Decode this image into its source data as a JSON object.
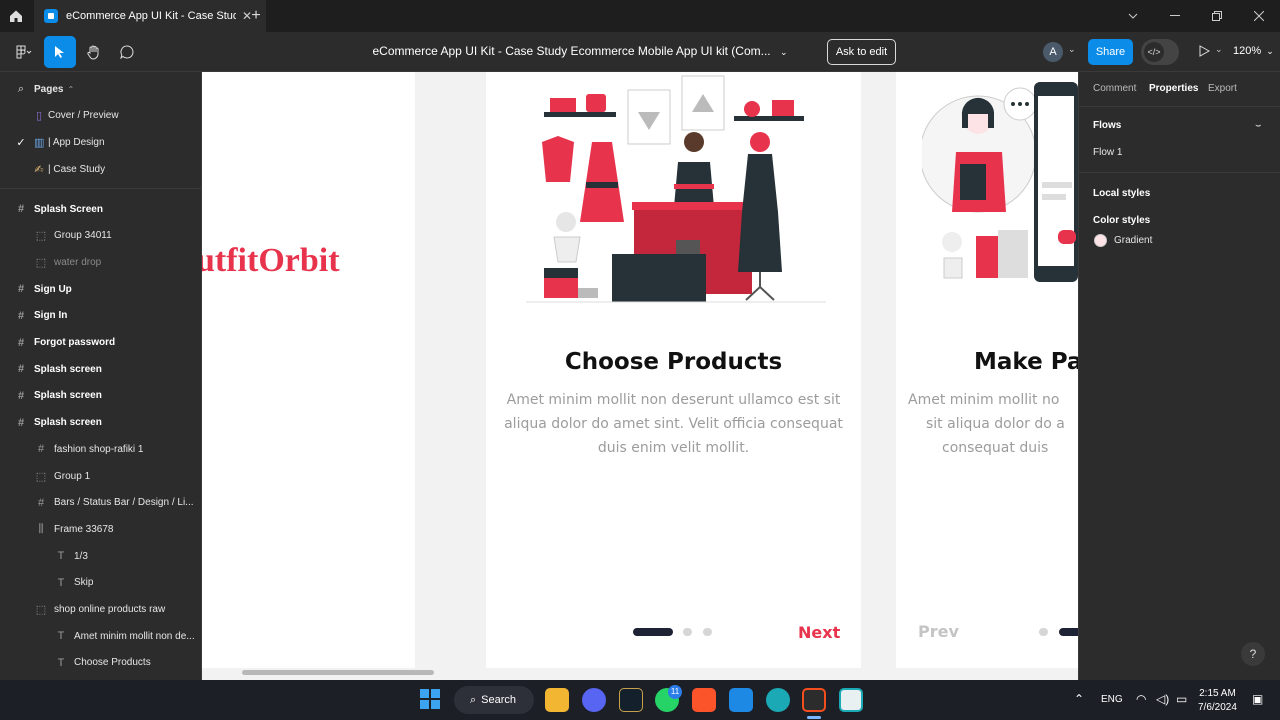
{
  "browser": {
    "tab_title": "eCommerce App UI Kit - Case Stud",
    "tab_close": "✕",
    "new_tab": "+"
  },
  "toolbar": {
    "doc_title": "eCommerce App UI Kit - Case Study Ecommerce Mobile App UI kit (Com...",
    "ask_to_edit": "Ask to edit",
    "avatar_letter": "A",
    "share": "Share",
    "zoom": "120%"
  },
  "pages": {
    "header": "Pages",
    "items": [
      "Cover / Preview",
      "| App Design",
      "| Case Study"
    ]
  },
  "layers": [
    {
      "label": "Splash Screen",
      "icon": "frame-icon",
      "indent": 0,
      "style": "bold"
    },
    {
      "label": "Group 34011",
      "icon": "group-icon",
      "indent": 1,
      "style": "normal"
    },
    {
      "label": "water drop",
      "icon": "group-icon",
      "indent": 1,
      "style": "dim"
    },
    {
      "label": "Sign Up",
      "icon": "frame-icon",
      "indent": 0,
      "style": "bold"
    },
    {
      "label": "Sign In",
      "icon": "frame-icon",
      "indent": 0,
      "style": "bold"
    },
    {
      "label": "Forgot password",
      "icon": "frame-icon",
      "indent": 0,
      "style": "bold"
    },
    {
      "label": "Splash screen",
      "icon": "frame-icon",
      "indent": 0,
      "style": "bold"
    },
    {
      "label": "Splash screen",
      "icon": "frame-icon",
      "indent": 0,
      "style": "bold"
    },
    {
      "label": "Splash screen",
      "icon": "frame-icon",
      "indent": 0,
      "style": "bold"
    },
    {
      "label": "fashion shop-rafiki 1",
      "icon": "frame-icon",
      "indent": 1,
      "style": "normal"
    },
    {
      "label": "Group 1",
      "icon": "group-icon",
      "indent": 1,
      "style": "normal"
    },
    {
      "label": "Bars / Status Bar / Design / Li...",
      "icon": "frame-icon",
      "indent": 1,
      "style": "normal"
    },
    {
      "label": "Frame 33678",
      "icon": "autolayout-icon",
      "indent": 1,
      "style": "normal"
    },
    {
      "label": "1/3",
      "icon": "text-icon",
      "indent": 2,
      "style": "normal"
    },
    {
      "label": "Skip",
      "icon": "text-icon",
      "indent": 2,
      "style": "normal"
    },
    {
      "label": "shop online products raw",
      "icon": "group-icon",
      "indent": 1,
      "style": "normal"
    },
    {
      "label": "Amet minim mollit non de...",
      "icon": "text-icon",
      "indent": 2,
      "style": "normal"
    },
    {
      "label": "Choose Products",
      "icon": "text-icon",
      "indent": 2,
      "style": "normal"
    }
  ],
  "canvas": {
    "brand_partial": "utfitOrbit",
    "screen_mid": {
      "heading": "Choose Products",
      "body": "Amet minim mollit non deserunt ullamco est sit aliqua dolor do amet sint. Velit officia consequat duis enim velit mollit.",
      "next": "Next"
    },
    "screen_right": {
      "heading": "Make Pa",
      "body": "Amet minim mollit no sit aliqua dolor do a consequat duis",
      "prev": "Prev"
    },
    "brand_color": "#e8334c"
  },
  "right_panel": {
    "tabs": [
      "Comment",
      "Properties",
      "Export"
    ],
    "flows_label": "Flows",
    "flow_item": "Flow 1",
    "local_styles": "Local styles",
    "color_styles": "Color styles",
    "gradient": "Gradient",
    "help": "?"
  },
  "taskbar": {
    "search": "Search",
    "lang": "ENG",
    "time": "2:15 AM",
    "date": "7/6/2024",
    "whatsapp_badge": "11"
  }
}
